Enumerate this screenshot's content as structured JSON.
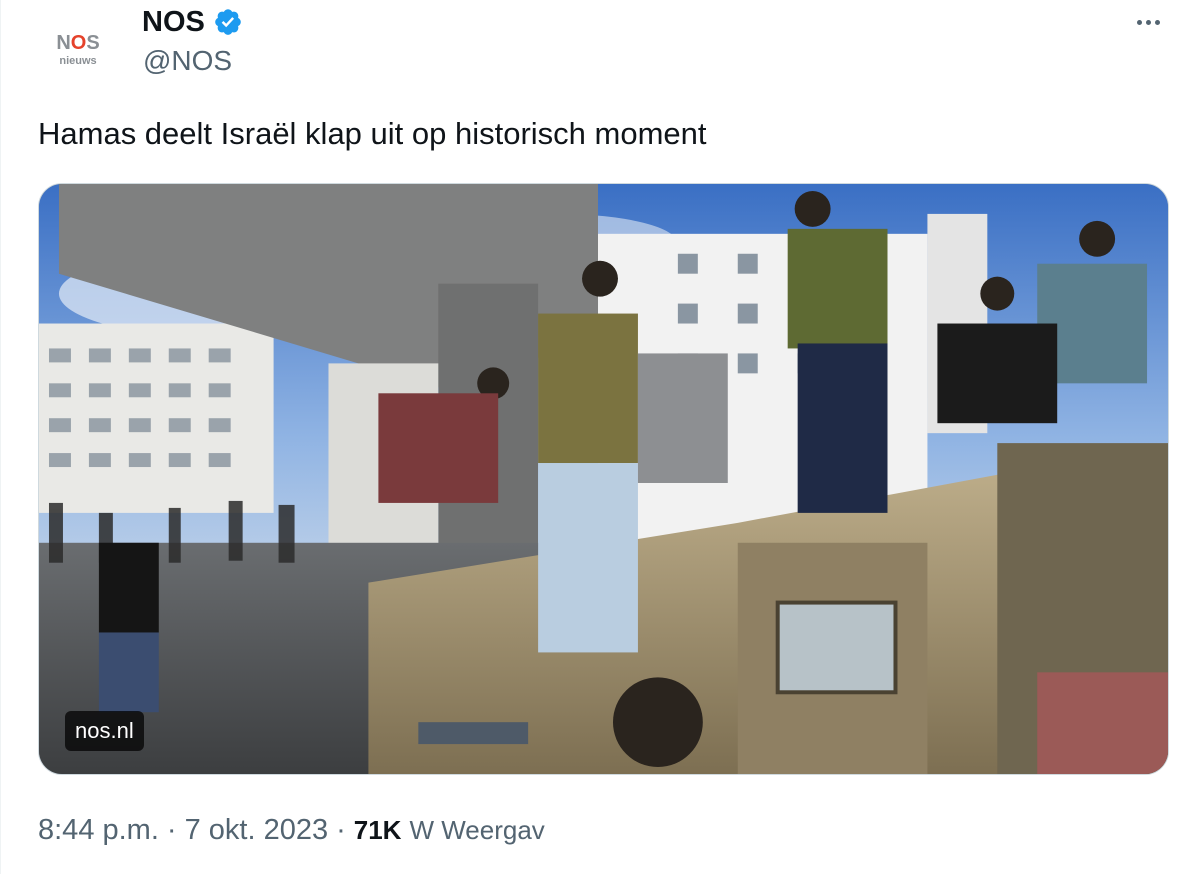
{
  "author": {
    "logo_main_prefix": "N",
    "logo_main_o": "O",
    "logo_main_suffix": "S",
    "logo_sub": "nieuws",
    "display_name": "NOS",
    "handle": "@NOS",
    "verified": true,
    "verified_color": "#1d9bf0"
  },
  "tweet": {
    "text": "Hamas deelt Israël klap uit op historisch moment"
  },
  "media": {
    "source_label": "nos.nl"
  },
  "meta": {
    "time": "8:44 p.m.",
    "separator": "·",
    "date": "7 okt. 2023",
    "views_count": "71K",
    "views_label": "W Weergav"
  },
  "colors": {
    "text": "#0f1419",
    "secondary": "#536471",
    "border": "#cfd9de",
    "nos_red": "#e5422b"
  },
  "icons": {
    "more": "more-horizontal-icon",
    "verified": "verified-badge-icon"
  }
}
